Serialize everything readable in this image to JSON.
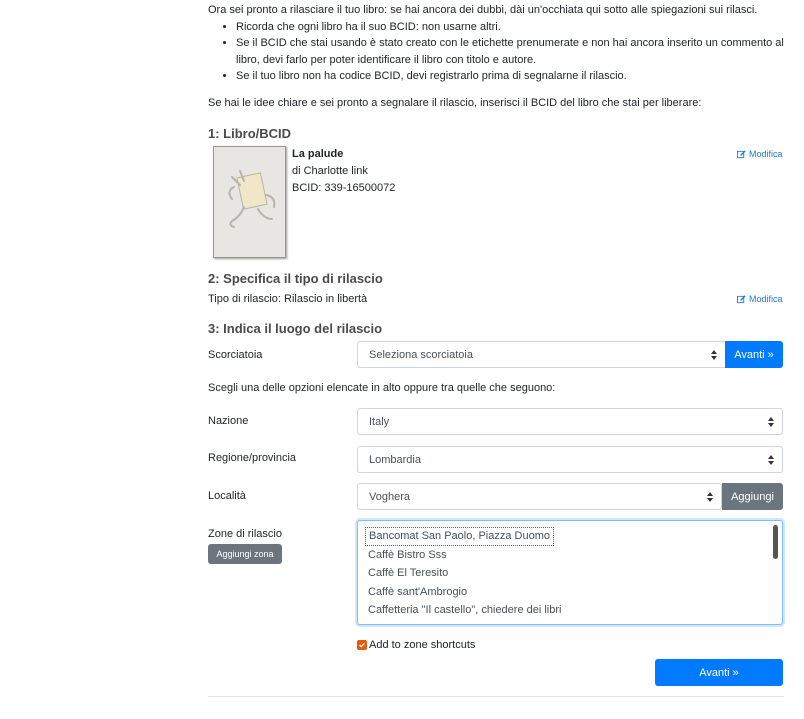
{
  "intro": {
    "line1": "Ora sei pronto a rilasciare il tuo libro: se hai ancora dei dubbi, dài un'occhiata qui sotto alle spiegazioni sui rilasci.",
    "bullets": [
      "Ricorda che ogni libro ha il suo BCID: non usarne altri.",
      "Se il BCID che stai usando è stato creato con le etichette prenumerate e non hai ancora inserito un commento al libro, devi farlo per poter identificare il libro con titolo e autore.",
      "Se il tuo libro non ha codice BCID, devi registrarlo prima di segnalarne il rilascio."
    ],
    "line2": "Se hai le idee chiare e sei pronto a segnalare il rilascio, inserisci il BCID del libro che stai per liberare:"
  },
  "section1": {
    "heading": "1: Libro/BCID",
    "title": "La palude",
    "author": "di Charlotte link",
    "bcid": "BCID: 339-16500072",
    "edit_label": "Modifica"
  },
  "section2": {
    "heading": "2: Specifica il tipo di rilascio",
    "tipo": "Tipo di rilascio: Rilascio in libertà",
    "edit_label": "Modifica"
  },
  "section3": {
    "heading": "3: Indica il luogo del rilascio",
    "scorciatoia_label": "Scorciatoia",
    "scorciatoia_value": "Seleziona scorciatoia",
    "avanti_small": "Avanti »",
    "hint": "Scegli una delle opzioni elencate in alto oppure tra quelle che seguono:",
    "nazione_label": "Nazione",
    "nazione_value": "Italy",
    "regione_label": "Regione/provincia",
    "regione_value": "Lombardia",
    "localita_label": "Località",
    "localita_value": "Voghera",
    "aggiungi_label": "Aggiungi",
    "zone_label": "Zone di rilascio",
    "aggiungi_zona_label": "Aggiungi zona",
    "zones": [
      "Bancomat San Paolo, Piazza Duomo",
      "Caffè Bistro Sss",
      "Caffè El Teresito",
      "Caffè sant'Ambrogio",
      "Caffetteria \"Il castello\", chiedere dei libri"
    ],
    "shortcut_label": "Add to zone shortcuts",
    "shortcut_checked": true,
    "avanti_big": "Avanti »"
  },
  "colors": {
    "primary": "#007bff",
    "secondary": "#6c757d",
    "link": "#1e7be0",
    "checkbox": "#e8590c"
  }
}
